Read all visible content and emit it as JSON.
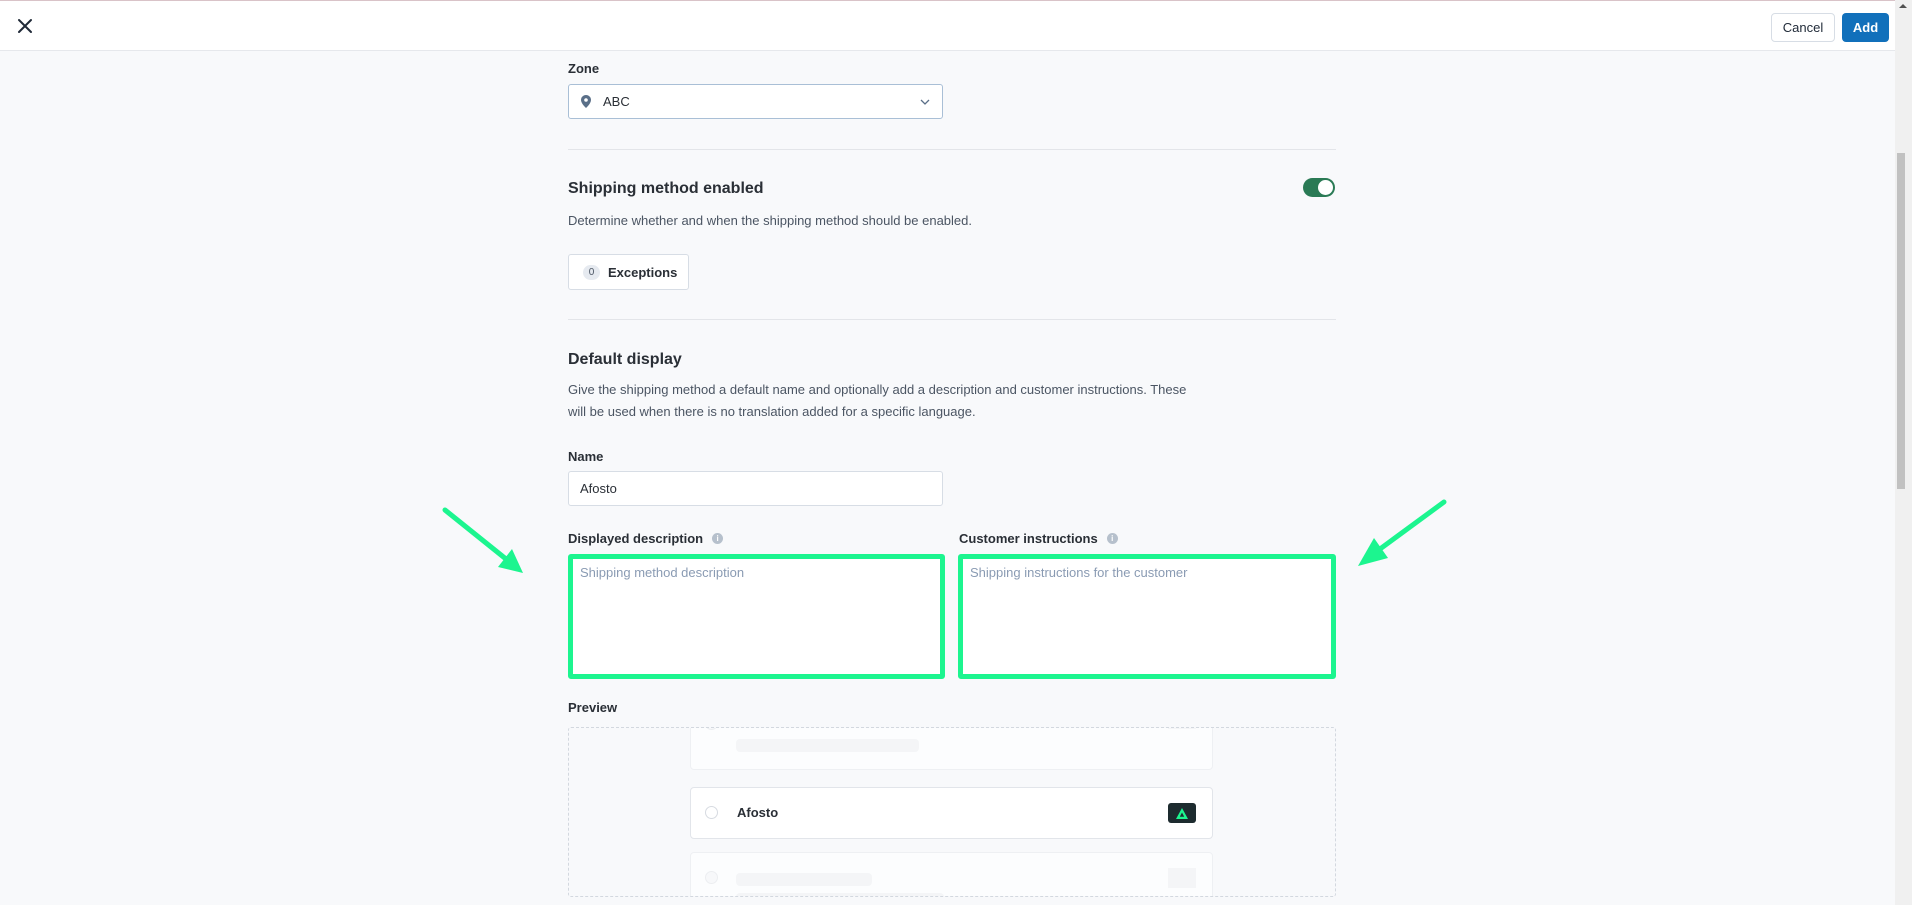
{
  "topbar": {
    "close_icon": "close-icon",
    "cancel_label": "Cancel",
    "add_label": "Add"
  },
  "zone": {
    "label": "Zone",
    "value": "ABC",
    "icon": "map-pin-icon"
  },
  "shipping_enabled": {
    "title": "Shipping method enabled",
    "description": "Determine whether and when the shipping method should be enabled.",
    "toggle_on": true,
    "exceptions_count": "0",
    "exceptions_label": "Exceptions"
  },
  "default_display": {
    "title": "Default display",
    "description_line1": "Give the shipping method a default name and optionally add a description and customer instructions. These",
    "description_line2": "will be used when there is no translation added for a specific language.",
    "name_label": "Name",
    "name_value": "Afosto",
    "description_label": "Displayed description",
    "description_placeholder": "Shipping method description",
    "instructions_label": "Customer instructions",
    "instructions_placeholder": "Shipping instructions for the customer"
  },
  "preview": {
    "label": "Preview",
    "option_name": "Afosto",
    "logo_icon": "afosto-logo-icon"
  },
  "annotations": {
    "highlight_color": "#1cf58f"
  },
  "colors": {
    "primary": "#1170bb",
    "toggle_on": "#2a7a55"
  }
}
